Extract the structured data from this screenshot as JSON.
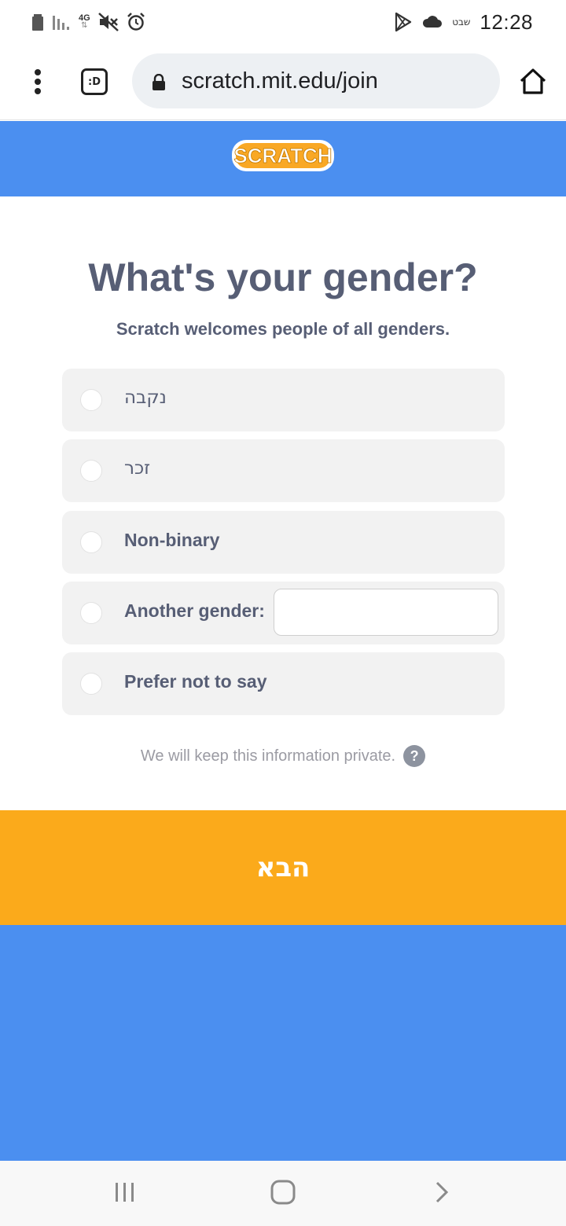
{
  "status_bar": {
    "time": "12:28",
    "network": "4G",
    "hebrew_day": "שבט"
  },
  "browser": {
    "url": "scratch.mit.edu/join",
    "tab_label": ":D"
  },
  "header": {
    "logo_text": "SCRATCH",
    "logo_color": "#f9a825",
    "background": "#4b8ff0"
  },
  "form": {
    "title": "What's your gender?",
    "subtitle": "Scratch welcomes people of all genders.",
    "options": [
      {
        "label": "נקבה"
      },
      {
        "label": "זכר"
      },
      {
        "label": "Non-binary"
      },
      {
        "label": "Another gender:"
      },
      {
        "label": "Prefer not to say"
      }
    ],
    "another_gender_value": "",
    "privacy_note": "We will keep this information private.",
    "help_icon": "?"
  },
  "actions": {
    "next_label": "הבא",
    "next_color": "#fbaa1b"
  }
}
